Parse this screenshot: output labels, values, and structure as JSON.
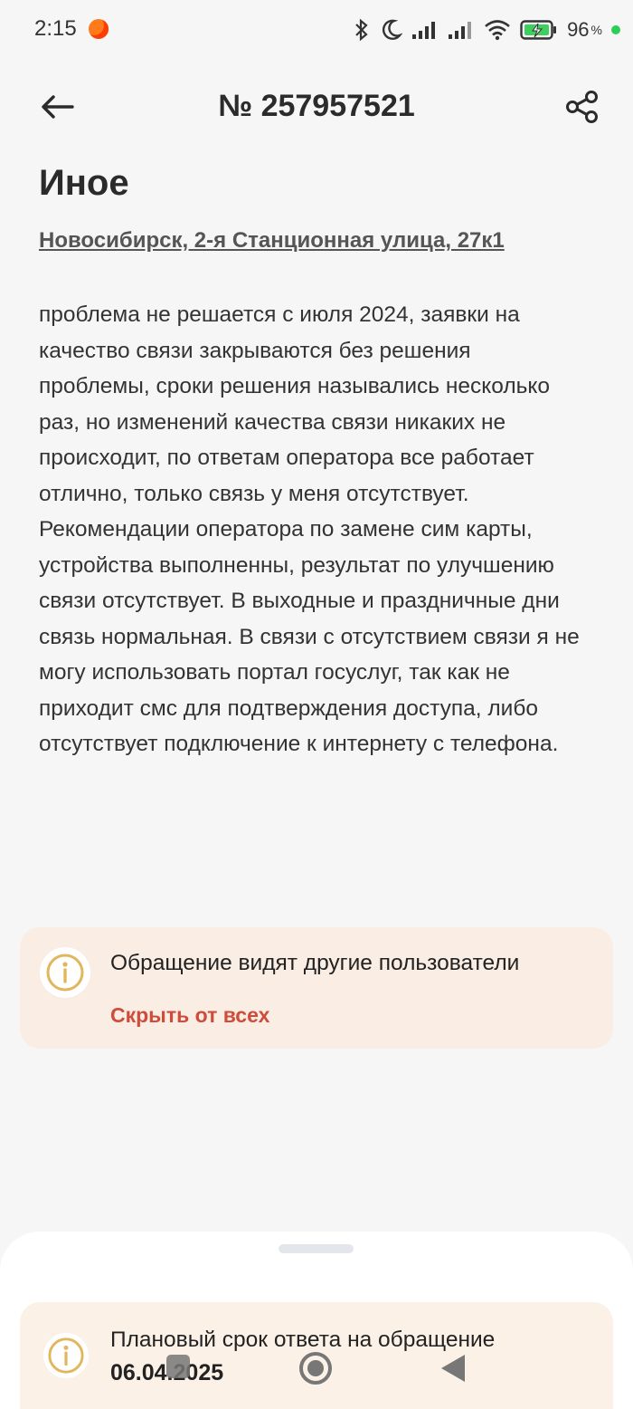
{
  "status_bar": {
    "time": "2:15",
    "battery_value": "96",
    "battery_unit": "%"
  },
  "header": {
    "title": "№ 257957521",
    "back_icon": "arrow-left-icon",
    "share_icon": "share-icon"
  },
  "appeal": {
    "category": "Иное",
    "address": "Новосибирск, 2-я Станционная улица, 27к1",
    "description": "проблема не решается с июля 2024, заявки на качество связи закрываются без решения проблемы, сроки решения назывались несколько раз, но изменений качества связи никаких не происходит, по ответам оператора все работает отлично, только связь у меня отсутствует. Рекомендации оператора по замене сим карты, устройства выполненны, результат по улучшению связи отсутствует. В выходные и праздничные дни связь нормальная. В связи с отсутствием связи я не могу использовать портал госуслуг, так как не приходит смс для подтверждения доступа, либо отсутствует подключение к интернету с телефона."
  },
  "visibility_card": {
    "text": "Обращение видят другие пользователи",
    "action": "Скрыть от всех",
    "icon": "info-icon"
  },
  "deadline_card": {
    "label": "Плановый срок ответа на обращение",
    "date": "06.04.2025",
    "icon": "info-icon"
  },
  "colors": {
    "accent_red": "#d04b3a",
    "card_bg": "#f9ede4",
    "info_gold": "#e2b65c"
  }
}
